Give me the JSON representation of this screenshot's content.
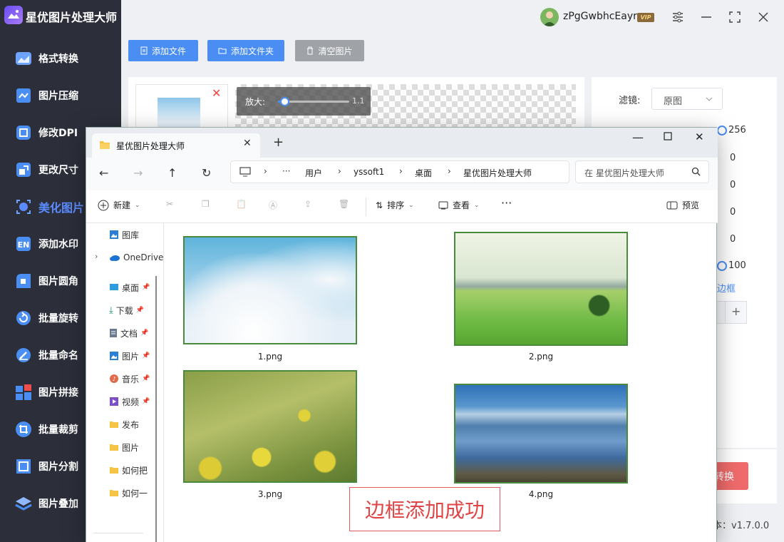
{
  "app": {
    "title": "星优图片处理大师",
    "user": "zPgGwbhcEayr",
    "vip": "VIP",
    "version": "本：v1.7.0.0"
  },
  "sidebar": {
    "items": [
      {
        "label": "格式转换",
        "icon": "format-convert-icon"
      },
      {
        "label": "图片压缩",
        "icon": "compress-icon"
      },
      {
        "label": "修改DPI",
        "icon": "dpi-icon"
      },
      {
        "label": "更改尺寸",
        "icon": "resize-icon"
      },
      {
        "label": "美化图片",
        "icon": "beautify-icon",
        "active": true
      },
      {
        "label": "添加水印",
        "icon": "watermark-icon"
      },
      {
        "label": "图片圆角",
        "icon": "round-corner-icon"
      },
      {
        "label": "批量旋转",
        "icon": "rotate-icon"
      },
      {
        "label": "批量命名",
        "icon": "rename-icon"
      },
      {
        "label": "图片拼接",
        "icon": "stitch-icon"
      },
      {
        "label": "批量裁剪",
        "icon": "crop-icon"
      },
      {
        "label": "图片分割",
        "icon": "split-icon"
      },
      {
        "label": "图片叠加",
        "icon": "overlay-icon"
      }
    ]
  },
  "toolbar": {
    "add_file": "添加文件",
    "add_folder": "添加文件夹",
    "clear": "清空图片"
  },
  "preview": {
    "zoom_label": "放大:",
    "zoom_value": "1.1",
    "zoom_level": 0.05
  },
  "settings": {
    "filter_label": "滤镜:",
    "filter_value": "原图",
    "values": [
      "256",
      "0",
      "0",
      "0",
      "0",
      "100"
    ],
    "border_link": "边框",
    "stepper_plus": "+",
    "convert_button": "转换"
  },
  "explorer": {
    "tab_title": "星优图片处理大师",
    "path": [
      "用户",
      "yssoft1",
      "桌面",
      "星优图片处理大师"
    ],
    "search_placeholder": "在 星优图片处理大师",
    "toolbar": {
      "new": "新建",
      "sort": "排序",
      "view": "查看",
      "preview": "预览"
    },
    "nav": [
      {
        "label": "图库",
        "icon": "gallery-icon"
      },
      {
        "label": "OneDrive",
        "icon": "onedrive-icon"
      },
      {
        "label": "桌面",
        "icon": "desktop-icon"
      },
      {
        "label": "下载",
        "icon": "download-icon"
      },
      {
        "label": "文档",
        "icon": "document-icon"
      },
      {
        "label": "图片",
        "icon": "pictures-icon"
      },
      {
        "label": "音乐",
        "icon": "music-icon"
      },
      {
        "label": "视频",
        "icon": "video-icon"
      },
      {
        "label": "发布",
        "icon": "folder-icon"
      },
      {
        "label": "图片",
        "icon": "folder-icon"
      },
      {
        "label": "如何把",
        "icon": "folder-icon"
      },
      {
        "label": "如何一",
        "icon": "folder-icon"
      }
    ],
    "files": [
      "1.png",
      "2.png",
      "3.png",
      "4.png"
    ]
  },
  "banner": {
    "text": "边框添加成功"
  },
  "colors": {
    "accent": "#4a8ef3",
    "sidebar": "#2c2f3a",
    "convert": "#ef6b6b",
    "banner_border": "#e05b5b",
    "thumb_border": "#4a8a3c"
  }
}
